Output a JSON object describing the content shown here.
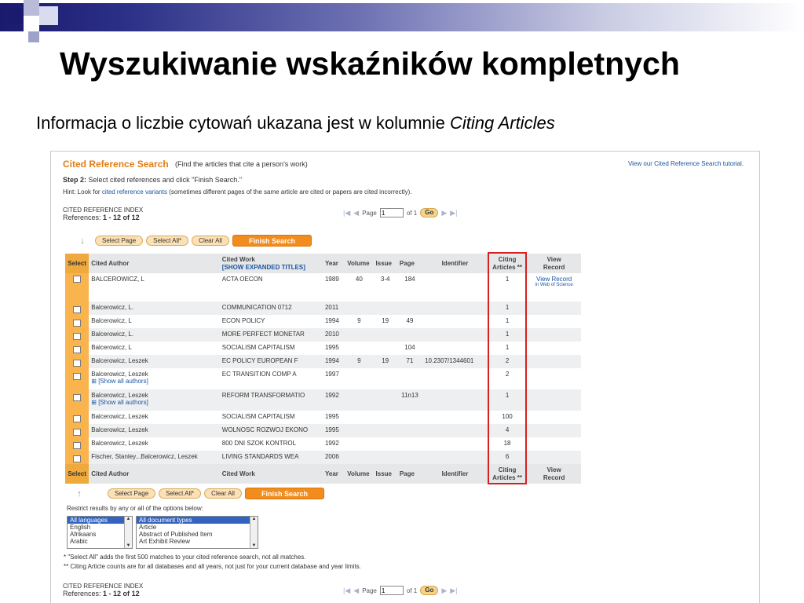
{
  "slide": {
    "title": "Wyszukiwanie wskaźników kompletnych",
    "subtitle_prefix": "Informacja o liczbie cytowań ukazana jest w kolumnie ",
    "subtitle_em": "Citing Articles"
  },
  "panel": {
    "header_title": "Cited Reference Search",
    "header_hint": "(Find the articles that cite a person's work)",
    "tutorial_link": "View our Cited Reference Search tutorial.",
    "step_label": "Step 2:",
    "step_text": "Select cited references and click \"Finish Search.\"",
    "hint_prefix": "Hint: Look for ",
    "hint_link": "cited reference variants",
    "hint_suffix": " (sometimes different pages of the same article are cited or papers are cited incorrectly).",
    "index_label": "CITED REFERENCE INDEX",
    "refs_label": "References:",
    "refs_range": "1 - 12 of",
    "refs_total": "12",
    "pager": {
      "page_label": "Page",
      "page_value": "1",
      "of_label": "of 1",
      "go_label": "Go"
    },
    "buttons": {
      "select_page": "Select Page",
      "select_all": "Select All*",
      "clear_all": "Clear All",
      "finish": "Finish Search"
    },
    "columns": {
      "select": "Select",
      "cited_author": "Cited Author",
      "cited_work": "Cited Work",
      "show_expanded": "SHOW EXPANDED TITLES",
      "year": "Year",
      "volume": "Volume",
      "issue": "Issue",
      "page": "Page",
      "identifier": "Identifier",
      "citing": "Citing",
      "articles": "Articles **",
      "view": "View",
      "record": "Record"
    },
    "show_all_authors": "[Show all authors]",
    "view_record_link": "View Record",
    "view_record_sub": "in Web of Science",
    "rows": [
      {
        "author": "BALCEROWICZ, L",
        "work": "ACTA OECON",
        "year": "1989",
        "volume": "40",
        "issue": "3-4",
        "page": "184",
        "identifier": "",
        "citing": "1"
      },
      {
        "author": "Balcerowicz, L.",
        "work": "COMMUNICATION 0712",
        "year": "2011",
        "volume": "",
        "issue": "",
        "page": "",
        "identifier": "",
        "citing": "1"
      },
      {
        "author": "Balcerowicz, L",
        "work": "ECON POLICY",
        "year": "1994",
        "volume": "9",
        "issue": "19",
        "page": "49",
        "identifier": "",
        "citing": "1"
      },
      {
        "author": "Balcerowicz, L.",
        "work": "MORE PERFECT MONETAR",
        "year": "2010",
        "volume": "",
        "issue": "",
        "page": "",
        "identifier": "",
        "citing": "1"
      },
      {
        "author": "Balcerowicz, L",
        "work": "SOCIALISM CAPITALISM",
        "year": "1995",
        "volume": "",
        "issue": "",
        "page": "104",
        "identifier": "",
        "citing": "1"
      },
      {
        "author": "Balcerowicz, Leszek",
        "work": "EC POLICY EUROPEAN F",
        "year": "1994",
        "volume": "9",
        "issue": "19",
        "page": "71",
        "identifier": "10.2307/1344601",
        "citing": "2"
      },
      {
        "author": "Balcerowicz, Leszek",
        "work": "EC TRANSITION COMP A",
        "year": "1997",
        "volume": "",
        "issue": "",
        "page": "",
        "identifier": "",
        "citing": "2"
      },
      {
        "author": "Balcerowicz, Leszek",
        "work": "REFORM TRANSFORMATIO",
        "year": "1992",
        "volume": "",
        "issue": "",
        "page": "11n13",
        "identifier": "",
        "citing": "1"
      },
      {
        "author": "Balcerowicz, Leszek",
        "work": "SOCIALISM CAPITALISM",
        "year": "1995",
        "volume": "",
        "issue": "",
        "page": "",
        "identifier": "",
        "citing": "100"
      },
      {
        "author": "Balcerowicz, Leszek",
        "work": "WOLNOSC ROZWOJ EKONO",
        "year": "1995",
        "volume": "",
        "issue": "",
        "page": "",
        "identifier": "",
        "citing": "4"
      },
      {
        "author": "Balcerowicz, Leszek",
        "work": "800 DNI SZOK KONTROL",
        "year": "1992",
        "volume": "",
        "issue": "",
        "page": "",
        "identifier": "",
        "citing": "18"
      },
      {
        "author": "Fischer, Stanley...Balcerowicz, Leszek",
        "work": "LIVING STANDARDS WEA",
        "year": "2006",
        "volume": "",
        "issue": "",
        "page": "",
        "identifier": "",
        "citing": "6"
      }
    ],
    "restrict_text": "Restrict results by any or all of the options below:",
    "languages": [
      "All languages",
      "English",
      "Afrikaans",
      "Arabic"
    ],
    "doc_types": [
      "All document types",
      "Article",
      "Abstract of Published Item",
      "Art Exhibit Review"
    ],
    "footnote1": "* \"Select All\" adds the first 500 matches to your cited reference search, not all matches.",
    "footnote2": "** Citing Article counts are for all databases and all years, not just for your current database and year limits."
  }
}
